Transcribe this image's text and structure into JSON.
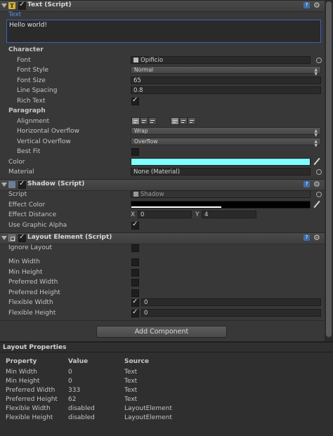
{
  "text_component": {
    "title": "Text (Script)",
    "text_label": "Text",
    "text_value": "Hello world!",
    "character_heading": "Character",
    "font_label": "Font",
    "font_value": "Opificio",
    "font_style_label": "Font Style",
    "font_style_value": "Normal",
    "font_size_label": "Font Size",
    "font_size_value": "65",
    "line_spacing_label": "Line Spacing",
    "line_spacing_value": "0.8",
    "rich_text_label": "Rich Text",
    "paragraph_heading": "Paragraph",
    "alignment_label": "Alignment",
    "horizontal_overflow_label": "Horizontal Overflow",
    "horizontal_overflow_value": "Wrap",
    "vertical_overflow_label": "Vertical Overflow",
    "vertical_overflow_value": "Overflow",
    "best_fit_label": "Best Fit",
    "color_label": "Color",
    "color_value": "#80ffff",
    "material_label": "Material",
    "material_value": "None (Material)"
  },
  "shadow_component": {
    "title": "Shadow (Script)",
    "script_label": "Script",
    "script_value": "Shadow",
    "effect_color_label": "Effect Color",
    "effect_color_value": "#000000",
    "effect_distance_label": "Effect Distance",
    "x_label": "X",
    "x_value": "0",
    "y_label": "Y",
    "y_value": "4",
    "use_graphic_alpha_label": "Use Graphic Alpha"
  },
  "layout_component": {
    "title": "Layout Element (Script)",
    "ignore_layout_label": "Ignore Layout",
    "min_width_label": "Min Width",
    "min_height_label": "Min Height",
    "preferred_width_label": "Preferred Width",
    "preferred_height_label": "Preferred Height",
    "flexible_width_label": "Flexible Width",
    "flexible_width_value": "0",
    "flexible_height_label": "Flexible Height",
    "flexible_height_value": "0"
  },
  "add_component_label": "Add Component",
  "layout_properties": {
    "title": "Layout Properties",
    "headers": [
      "Property",
      "Value",
      "Source"
    ],
    "rows": [
      [
        "Min Width",
        "0",
        "Text"
      ],
      [
        "Min Height",
        "0",
        "Text"
      ],
      [
        "Preferred Width",
        "333",
        "Text"
      ],
      [
        "Preferred Height",
        "62",
        "Text"
      ],
      [
        "Flexible Width",
        "disabled",
        "LayoutElement"
      ],
      [
        "Flexible Height",
        "disabled",
        "LayoutElement"
      ]
    ]
  },
  "icons": {
    "text": "T",
    "help": "?",
    "gear": "⚙"
  }
}
